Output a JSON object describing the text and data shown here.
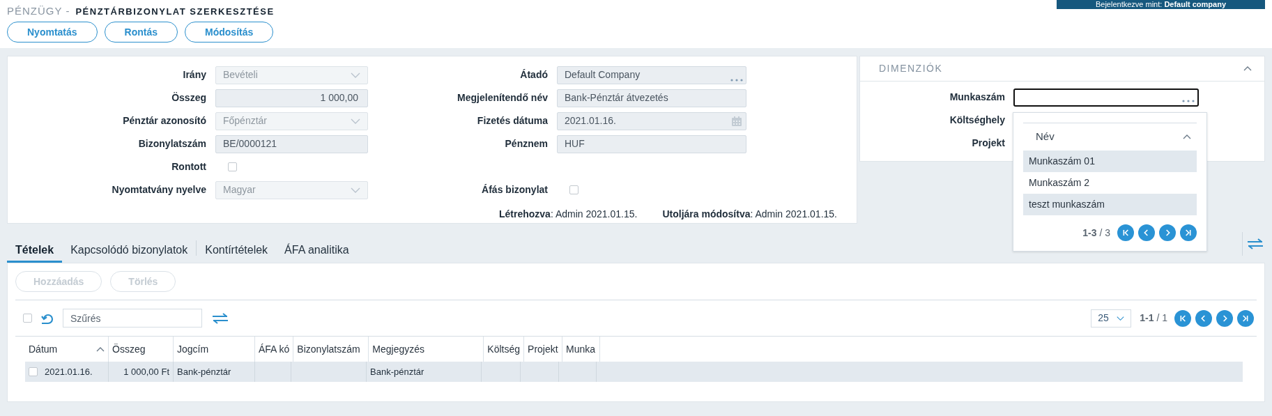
{
  "header": {
    "section": "PÉNZÜGY -",
    "title": "PÉNZTÁRBIZONYLAT SZERKESZTÉSE",
    "login": "Bejelentkezve mint: **Default company**"
  },
  "actions": [
    "Nyomtatás",
    "Rontás",
    "Módosítás"
  ],
  "form_left": [
    {
      "kind": "select",
      "label": "Irány",
      "value": "Bevételi"
    },
    {
      "kind": "number",
      "label": "Összeg",
      "value": "1 000,00"
    },
    {
      "kind": "select",
      "label": "Pénztár azonosító",
      "value": "Főpénztár"
    },
    {
      "kind": "text",
      "label": "Bizonylatszám",
      "value": "BE/0000121"
    },
    {
      "kind": "checkbox",
      "label": "Rontott",
      "checked": false
    },
    {
      "kind": "select",
      "label": "Nyomtatvány nyelve",
      "value": "Magyar"
    }
  ],
  "form_right": [
    {
      "kind": "lookup",
      "label": "Átadó",
      "value": "Default Company"
    },
    {
      "kind": "text",
      "label": "Megjelenítendő név",
      "value": "Bank-Pénztár átvezetés"
    },
    {
      "kind": "date",
      "label": "Fizetés dátuma",
      "value": "2021.01.16."
    },
    {
      "kind": "text",
      "label": "Pénznem",
      "value": "HUF"
    },
    {
      "kind": "checkbox",
      "label": "Áfás bizonylat",
      "checked": false
    }
  ],
  "audit": [
    "**Létrehozva**: Admin 2021.01.15.",
    "**Utoljára módosítva**: Admin 2021.01.15."
  ],
  "dimensions": {
    "title": "DIMENZIÓK",
    "expanded": true,
    "fields": [
      {
        "label": "Munkaszám",
        "focused": true
      },
      {
        "label": "Költséghely"
      },
      {
        "label": "Projekt"
      }
    ],
    "dropdown": {
      "column": "Név",
      "items": [
        "Munkaszám 01",
        "Munkaszám 2",
        "teszt munkaszám"
      ],
      "pager": "**1-3** / 3"
    }
  },
  "tabs": [
    {
      "label": "Tételek",
      "selected": true
    },
    {
      "label": "Kapcsolódó bizonylatok",
      "selected": false
    },
    {
      "label": "Kontírtételek",
      "selected": false
    },
    {
      "label": "ÁFA analitika",
      "selected": false
    }
  ],
  "item_actions": [
    {
      "label": "Hozzáadás",
      "disabled": true
    },
    {
      "label": "Törlés",
      "disabled": true
    }
  ],
  "toolbar": {
    "select_all": false,
    "filter_placeholder": "Szűrés",
    "page_size": "25",
    "pager": "**1-1** / 1"
  },
  "table": {
    "columns": [
      {
        "label": "Dátum",
        "sorted": true
      },
      {
        "label": "Összeg",
        "sorted": false
      },
      {
        "label": "Jogcím",
        "sorted": false
      },
      {
        "label": "ÁFA kó",
        "sorted": false
      },
      {
        "label": "Bizonylatszám",
        "sorted": false
      },
      {
        "label": "Megjegyzés",
        "sorted": false
      },
      {
        "label": "Költség",
        "sorted": false
      },
      {
        "label": "Projekt",
        "sorted": false
      },
      {
        "label": "Munka",
        "sorted": false
      }
    ],
    "rows": [
      {
        "checked": false,
        "cells": [
          "2021.01.16.",
          "1 000,00 Ft",
          "Bank-pénztár",
          "",
          "",
          "Bank-pénztár",
          "",
          "",
          ""
        ]
      }
    ]
  }
}
